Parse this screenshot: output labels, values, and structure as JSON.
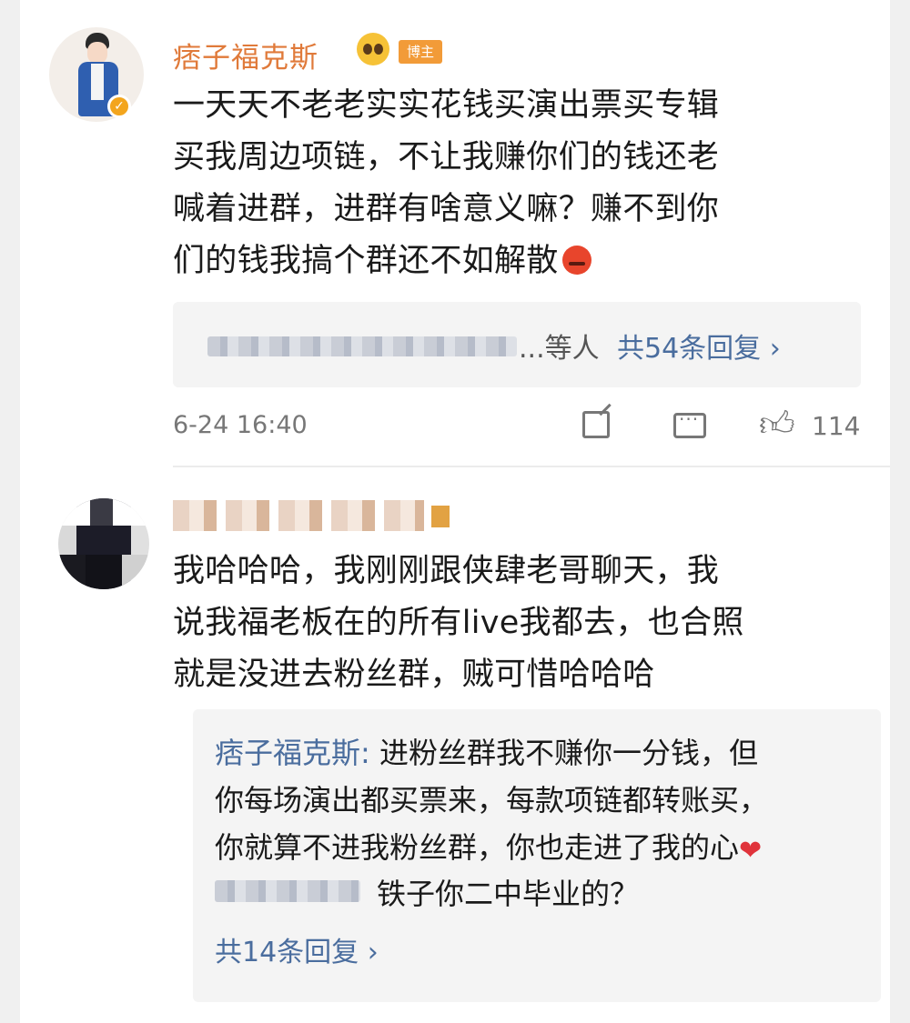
{
  "post": {
    "username": "痞子福克斯",
    "badge": "博主",
    "lines": [
      "一天天不老老实实花钱买演出票买专辑",
      "买我周边项链，不让我赚你们的钱还老",
      "喊着进群，进群有啥意义嘛？赚不到你",
      "们的钱我搞个群还不如解散"
    ],
    "others_label": "...等人",
    "reply_count": "共54条回复 ›",
    "timestamp": "6-24 16:40",
    "like_count": "114"
  },
  "comment": {
    "lines": [
      "我哈哈哈，我刚刚跟侠肆老哥聊天，我",
      "说我福老板在的所有live我都去，也合照",
      "就是没进去粉丝群，贼可惜哈哈哈"
    ],
    "reply": {
      "author": "痞子福克斯:",
      "text_line1": " 进粉丝群我不赚你一分钱，但",
      "text_line2": "你每场演出都买票来，每款项链都转账买，",
      "text_line3": "你就算不进我粉丝群，你也走进了我的心"
    },
    "subreply": "铁子你二中毕业的？",
    "more_replies": "共14条回复 ›"
  }
}
